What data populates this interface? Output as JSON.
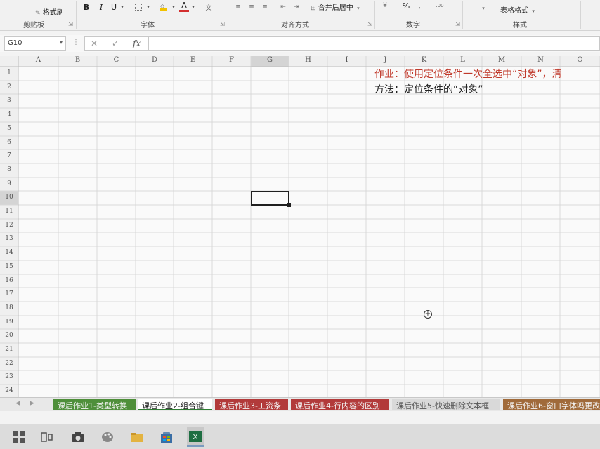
{
  "ribbon": {
    "format_painter": "格式刷",
    "bold": "B",
    "italic": "I",
    "underline": "U",
    "font_color_glyph": "A",
    "merge_center": "合并后居中",
    "percent": "%",
    "comma": ",",
    "table_format": "表格格式",
    "groups": {
      "clipboard": "剪贴板",
      "font": "字体",
      "alignment": "对齐方式",
      "number": "数字",
      "styles": "样式"
    }
  },
  "formula_bar": {
    "name_box": "G10",
    "fx": "fx",
    "cancel": "✕",
    "confirm": "✓",
    "formula": ""
  },
  "columns": [
    "A",
    "B",
    "C",
    "D",
    "E",
    "F",
    "G",
    "H",
    "I",
    "J",
    "K",
    "L",
    "M",
    "N",
    "O"
  ],
  "rows": [
    "1",
    "2",
    "3",
    "4",
    "5",
    "6",
    "7",
    "8",
    "9",
    "10",
    "11",
    "12",
    "13",
    "14",
    "15",
    "16",
    "17",
    "18",
    "19",
    "20",
    "21",
    "22",
    "23",
    "24"
  ],
  "cells": {
    "J1": "作业：使用定位条件一次全选中“对象”，清",
    "J2": "方法：定位条件的“对象”"
  },
  "active_cell": "G10",
  "sheet_tabs": [
    {
      "label": "课后作业1-类型转换",
      "color": "#4e8f3a"
    },
    {
      "label": "课后作业2-组合键",
      "color": "#ffffff",
      "active": true
    },
    {
      "label": "课后作业3-工资条",
      "color": "#b23a3a"
    },
    {
      "label": "课后作业4-行内容的区别",
      "color": "#b23a3a"
    },
    {
      "label": "课后作业5-快速删除文本框",
      "color": "#d9d9d9"
    },
    {
      "label": "课后作业6-窗口字体吗更改",
      "color": "#a06a3a"
    }
  ],
  "colors": {
    "accent_red": "#c0392b",
    "text_dark": "#222222",
    "selection": "#1f1f1f"
  }
}
